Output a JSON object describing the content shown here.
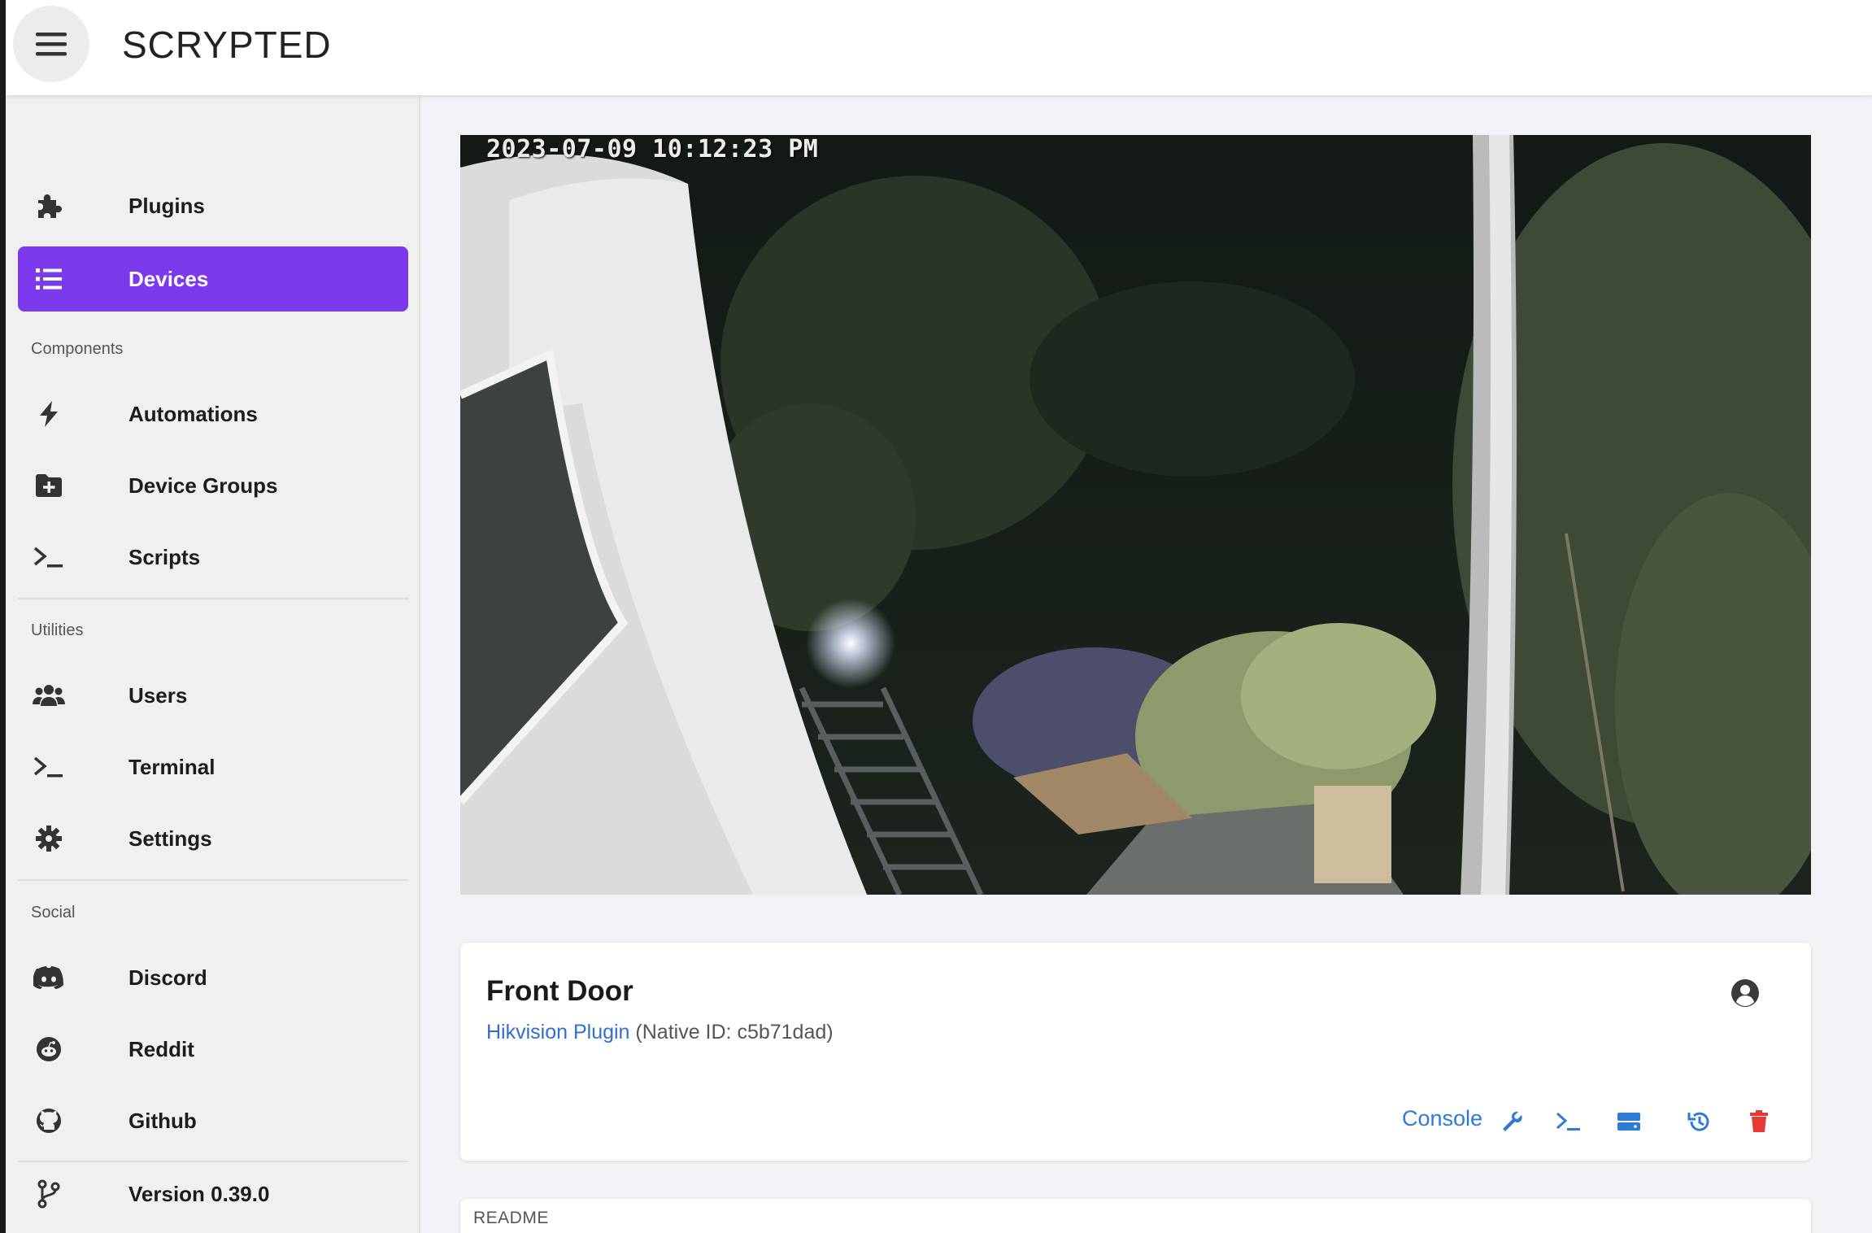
{
  "app": {
    "title": "SCRYPTED"
  },
  "sidebar": {
    "items": [
      {
        "label": "Plugins",
        "icon": "puzzle-icon"
      },
      {
        "label": "Devices",
        "icon": "list-icon",
        "active": true
      }
    ],
    "components": {
      "label": "Components",
      "items": [
        {
          "label": "Automations",
          "icon": "bolt-icon"
        },
        {
          "label": "Device Groups",
          "icon": "folder-plus-icon"
        },
        {
          "label": "Scripts",
          "icon": "terminal-icon"
        }
      ]
    },
    "utilities": {
      "label": "Utilities",
      "items": [
        {
          "label": "Users",
          "icon": "users-icon"
        },
        {
          "label": "Terminal",
          "icon": "terminal-icon"
        },
        {
          "label": "Settings",
          "icon": "gear-icon"
        }
      ]
    },
    "social": {
      "label": "Social",
      "items": [
        {
          "label": "Discord",
          "icon": "discord-icon"
        },
        {
          "label": "Reddit",
          "icon": "reddit-icon"
        },
        {
          "label": "Github",
          "icon": "github-icon"
        }
      ]
    },
    "version": {
      "label": "Version 0.39.0",
      "icon": "git-branch-icon"
    }
  },
  "camera": {
    "timestamp": "2023-07-09 10:12:23 PM"
  },
  "device": {
    "name": "Front Door",
    "plugin_link": "Hikvision Plugin",
    "native_id": "(Native ID: c5b71dad)",
    "actions": {
      "console_label": "Console",
      "icons": [
        "wrench-icon",
        "terminal-icon",
        "storage-icon",
        "history-icon",
        "trash-icon"
      ]
    }
  },
  "readme": {
    "label": "README"
  },
  "colors": {
    "accent": "#7c3aed",
    "link": "#2f6fd1",
    "action": "#2f7ad6",
    "danger": "#e53935"
  }
}
